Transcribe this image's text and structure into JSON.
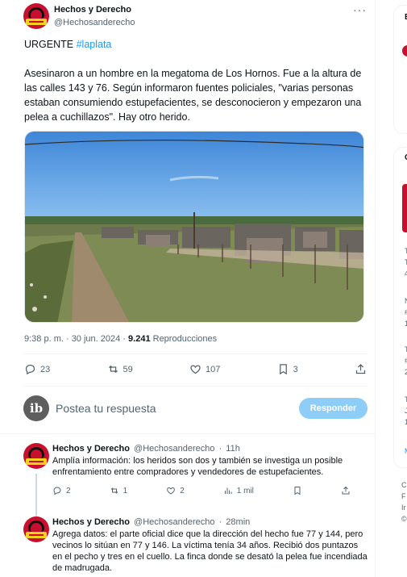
{
  "tweet": {
    "author_name": "Hechos y Derecho",
    "author_handle": "@Hechosanderecho",
    "more_icon": "···",
    "line1_prefix": "URGENTE ",
    "hashtag": "#laplata",
    "line2": "Asesinaron a un hombre en la megatoma de Los Hornos. Fue a la altura de las calles 143 y 76. Según informaron fuentes policiales, \"varias personas estaban consumiendo estupefacientes, se desconocieron y empezaron una pelea a cuchillazos\". Hay otro herido.",
    "timestamp": "9:38 p. m. · 30 jun. 2024 · ",
    "views_count": "9.241",
    "views_label": " Reproducciones",
    "replies": "23",
    "retweets": "59",
    "likes": "107",
    "bookmarks": "3"
  },
  "compose": {
    "avatar_text": "ib",
    "placeholder": "Postea tu respuesta",
    "button_label": "Responder"
  },
  "replies": [
    {
      "author_name": "Hechos y Derecho",
      "author_handle": "@Hechosanderecho",
      "time": "11h",
      "text": "Amplía información: los heridos son dos y también se investiga un posible enfrentamiento entre compradores y vendedores de estupefacientes.",
      "replies": "2",
      "retweets": "1",
      "likes": "2",
      "views": "1 mil"
    },
    {
      "author_name": "Hechos y Derecho",
      "author_handle": "@Hechosanderecho",
      "time": "28min",
      "text": "Agrega datos: el parte oficial dice que la dirección del hecho fue 77 y 144, pero vecinos lo sitúan en 77 y 146. La víctima tenía 34 años. Recibió dos puntazos en el pecho y tres en el cuello. La finca donde se desató la pelea fue incendiada de madrugada."
    }
  ],
  "right_column": {
    "fragments": [
      "T",
      "T",
      "4",
      "N",
      "#",
      "1",
      "T",
      "#",
      "2",
      "T",
      "J",
      "1",
      "M",
      "C",
      "F",
      "Ir",
      "©"
    ]
  },
  "colors": {
    "accent": "#1d9bf0",
    "button_disabled": "#8ecdf8",
    "brand_red": "#c8102e"
  }
}
